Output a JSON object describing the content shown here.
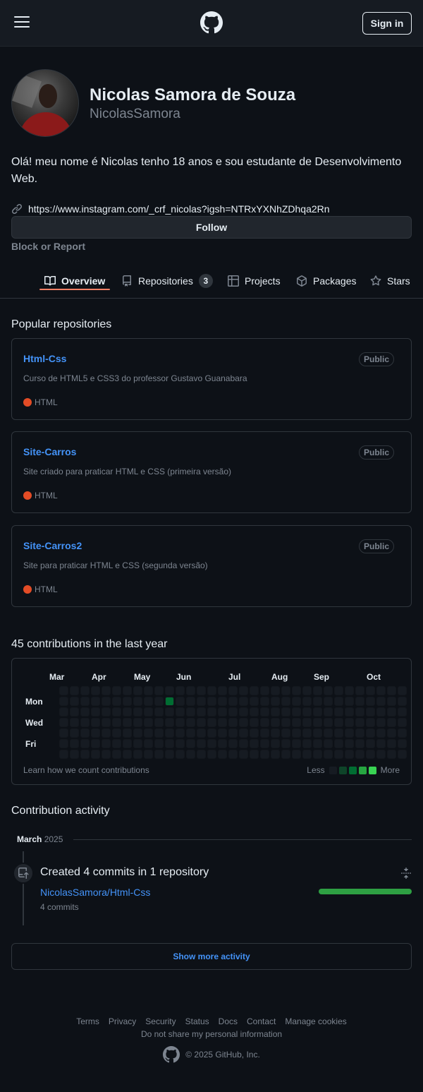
{
  "header": {
    "signin_label": "Sign in"
  },
  "profile": {
    "fullname": "Nicolas Samora de Souza",
    "username": "NicolasSamora",
    "bio": "Olá! meu nome é Nicolas tenho 18 anos e sou estudante de Desenvolvimento Web.",
    "link": "https://www.instagram.com/_crf_nicolas?igsh=NTRxYXNhZDhqa2Rn",
    "follow_label": "Follow",
    "block_report": "Block or Report"
  },
  "tabs": [
    {
      "label": "Overview",
      "icon": "book-icon",
      "active": true
    },
    {
      "label": "Repositories",
      "icon": "repo-icon",
      "count": "3"
    },
    {
      "label": "Projects",
      "icon": "table-icon"
    },
    {
      "label": "Packages",
      "icon": "package-icon"
    },
    {
      "label": "Stars",
      "icon": "star-icon"
    }
  ],
  "popular": {
    "title": "Popular repositories",
    "repos": [
      {
        "name": "Html-Css",
        "visibility": "Public",
        "description": "Curso de HTML5 e CSS3 do professor Gustavo Guanabara",
        "language": "HTML"
      },
      {
        "name": "Site-Carros",
        "visibility": "Public",
        "description": "Site criado para praticar HTML e CSS (primeira versão)",
        "language": "HTML"
      },
      {
        "name": "Site-Carros2",
        "visibility": "Public",
        "description": "Site para praticar HTML e CSS (segunda versão)",
        "language": "HTML"
      }
    ]
  },
  "contributions": {
    "title": "45 contributions in the last year",
    "months": [
      "Mar",
      "Apr",
      "May",
      "Jun",
      "Jul",
      "Aug",
      "Sep",
      "Oct"
    ],
    "days": [
      "Mon",
      "Wed",
      "Fri"
    ],
    "learn": "Learn how we count contributions",
    "less": "Less",
    "more": "More",
    "legend_colors": [
      "#161b22",
      "#0e4429",
      "#006d32",
      "#26a641",
      "#39d353"
    ],
    "active_cells": [
      {
        "week": 10,
        "day": 1,
        "level": 2
      }
    ]
  },
  "activity": {
    "title": "Contribution activity",
    "month": "March",
    "year": "2025",
    "item_title": "Created 4 commits in 1 repository",
    "item_repo": "NicolasSamora/Html-Css",
    "item_count": "4 commits",
    "show_more": "Show more activity"
  },
  "footer": {
    "links": [
      "Terms",
      "Privacy",
      "Security",
      "Status",
      "Docs",
      "Contact",
      "Manage cookies"
    ],
    "dnt": "Do not share my personal information",
    "copyright": "© 2025 GitHub, Inc."
  }
}
